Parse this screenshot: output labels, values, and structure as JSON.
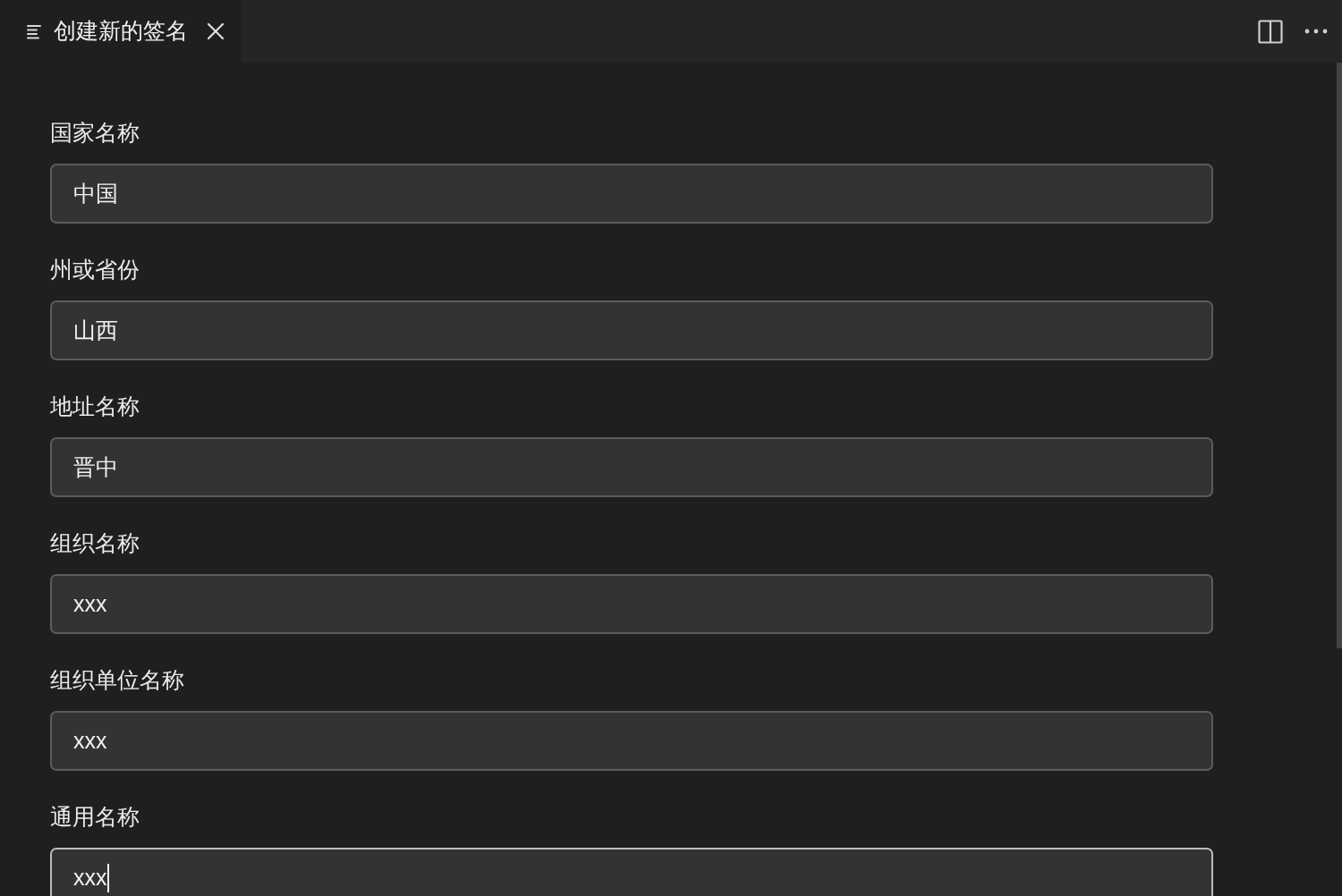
{
  "tabs": [
    {
      "title": "创建新的签名",
      "selected": true
    }
  ],
  "fields": [
    {
      "label": "国家名称",
      "value": "中国",
      "focused": false
    },
    {
      "label": "州或省份",
      "value": "山西",
      "focused": false
    },
    {
      "label": "地址名称",
      "value": "晋中",
      "focused": false
    },
    {
      "label": "组织名称",
      "value": "xxx",
      "focused": false
    },
    {
      "label": "组织单位名称",
      "value": "xxx",
      "focused": false
    },
    {
      "label": "通用名称",
      "value": "xxx",
      "focused": true
    }
  ]
}
